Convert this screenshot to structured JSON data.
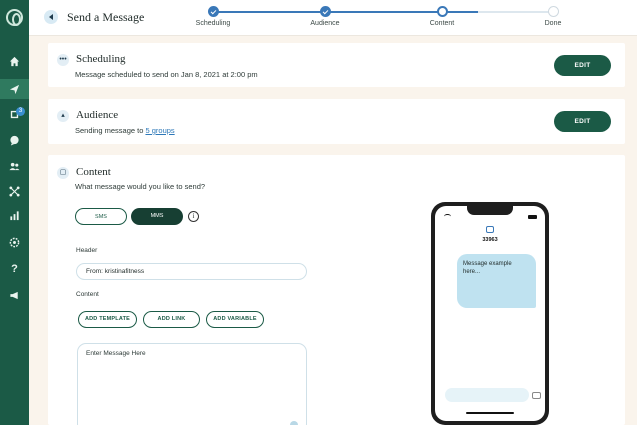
{
  "sidebar": {
    "logo": "brand-logo",
    "items": [
      {
        "name": "home-icon",
        "active": false
      },
      {
        "name": "send-icon",
        "active": true
      },
      {
        "name": "inbox-icon",
        "badge": "3",
        "active": false
      },
      {
        "name": "chat-icon",
        "active": false
      },
      {
        "name": "contacts-icon",
        "active": false
      },
      {
        "name": "integrations-icon",
        "active": false
      },
      {
        "name": "analytics-icon",
        "active": false
      },
      {
        "name": "settings-icon",
        "active": false
      },
      {
        "name": "help-icon",
        "label": "?",
        "active": false
      },
      {
        "name": "megaphone-icon",
        "active": false
      }
    ]
  },
  "header": {
    "title": "Send a Message"
  },
  "stepper": {
    "progress": 0.78,
    "steps": [
      {
        "label": "Scheduling",
        "state": "done"
      },
      {
        "label": "Audience",
        "state": "done"
      },
      {
        "label": "Content",
        "state": "current"
      },
      {
        "label": "Done",
        "state": "todo"
      }
    ]
  },
  "scheduling": {
    "title": "Scheduling",
    "summary": "Message scheduled to send on Jan 8, 2021 at 2:00 pm",
    "edit_label": "EDIT"
  },
  "audience": {
    "title": "Audience",
    "summary_prefix": "Sending message to ",
    "summary_link": "5 groups",
    "edit_label": "EDIT"
  },
  "content": {
    "title": "Content",
    "question": "What message would you like to send?",
    "type_sms": "SMS",
    "type_mms": "MMS",
    "selected_type": "MMS",
    "info_glyph": "i",
    "header_label": "Header",
    "header_value": "From: kristinafitness",
    "content_label": "Content",
    "add_template": "ADD TEMPLATE",
    "add_link": "ADD LINK",
    "add_variable": "ADD VARIABLE",
    "message_placeholder": "Enter Message Here"
  },
  "preview": {
    "shortcode": "33963",
    "bubble_text": "Message example here..."
  },
  "colors": {
    "brand_green": "#1b5a46",
    "accent_blue": "#3a78b8",
    "bubble_blue": "#bfe2f0",
    "background": "#faf4ec"
  }
}
